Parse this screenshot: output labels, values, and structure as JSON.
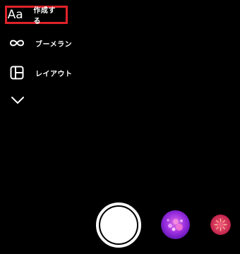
{
  "mode_menu": {
    "create": {
      "icon": "text-aa-icon",
      "glyph": "Aa",
      "label": "作成する",
      "highlight_color": "#e0222c"
    },
    "boomerang": {
      "icon": "infinity-icon",
      "label": "ブーメラン"
    },
    "layout": {
      "icon": "layout-grid-icon",
      "label": "レイアウト"
    },
    "expand": {
      "icon": "chevron-down-icon"
    }
  },
  "capture": {
    "shutter": {
      "icon": "shutter-button-icon"
    },
    "effects": [
      {
        "icon": "purple-bubbles-effect-icon",
        "colors": [
          "#7a1fd6",
          "#d14bd6"
        ]
      },
      {
        "icon": "red-sparkle-effect-icon",
        "colors": [
          "#c9204f",
          "#f0708a"
        ]
      }
    ]
  },
  "background_color": "#000000"
}
